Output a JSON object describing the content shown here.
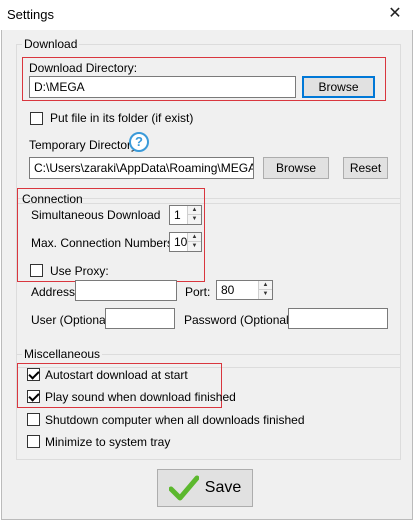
{
  "window": {
    "title": "Settings",
    "close_glyph": "✕"
  },
  "download": {
    "group_title": "Download",
    "directory_label": "Download Directory:",
    "directory_value": "D:\\MEGA",
    "browse_label": "Browse",
    "put_file_label": "Put file in its folder (if exist)",
    "put_file_checked": false,
    "temp_label": "Temporary Directory:",
    "temp_value": "C:\\Users\\zaraki\\AppData\\Roaming\\MEGA Lin",
    "temp_browse_label": "Browse",
    "reset_label": "Reset",
    "help_glyph": "?"
  },
  "connection": {
    "group_title": "Connection",
    "simultaneous_label": "Simultaneous Download",
    "simultaneous_value": "1",
    "max_conn_label": "Max. Connection Numbers",
    "max_conn_value": "10",
    "use_proxy_label": "Use Proxy:",
    "use_proxy_checked": false,
    "address_label": "Address:",
    "address_value": "",
    "port_label": "Port:",
    "port_value": "80",
    "user_label": "User (Optional):",
    "user_value": "",
    "password_label": "Password (Optional):",
    "password_value": ""
  },
  "misc": {
    "group_title": "Miscellaneous",
    "autostart_label": "Autostart download at start",
    "autostart_checked": true,
    "play_sound_label": "Play sound when download finished",
    "play_sound_checked": true,
    "shutdown_label": "Shutdown computer when all downloads finished",
    "shutdown_checked": false,
    "minimize_label": "Minimize to system tray",
    "minimize_checked": false
  },
  "footer": {
    "save_label": "Save"
  },
  "colors": {
    "highlight": "#d9363e",
    "help": "#3a9ad9",
    "save_check": "#5cb82e"
  },
  "icons": {
    "help": "help-icon",
    "save": "checkmark-icon",
    "close": "close-icon"
  }
}
